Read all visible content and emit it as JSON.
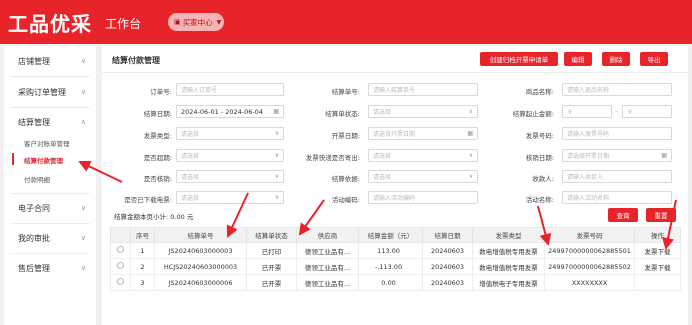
{
  "header": {
    "logo": "工品优采",
    "workbench": "工作台",
    "org_label": "买家中心"
  },
  "sidebar": {
    "items": [
      {
        "label": "店铺管理"
      },
      {
        "label": "采购订单管理"
      },
      {
        "label": "结算管理"
      },
      {
        "label": "电子合同"
      },
      {
        "label": "我的审批"
      },
      {
        "label": "售后管理"
      }
    ],
    "sub_items": [
      {
        "label": "客户对账单管理"
      },
      {
        "label": "结算付款管理"
      },
      {
        "label": "付款明细"
      }
    ]
  },
  "page": {
    "title": "结算付款管理",
    "buttons": {
      "create": "创建归档开票申请单",
      "edit": "编辑",
      "delete": "删除",
      "export": "导出",
      "search": "查询",
      "reset": "重置"
    }
  },
  "filters": {
    "order_no": {
      "label": "订单号:",
      "placeholder": "请输入订单号"
    },
    "settle_no": {
      "label": "结算单号:",
      "placeholder": "请输入结算单号"
    },
    "product_name": {
      "label": "商品名称:",
      "placeholder": "请输入商品名称"
    },
    "settle_date": {
      "label": "结算日期:",
      "value": "2024-06-01 - 2024-06-04"
    },
    "settle_status": {
      "label": "结算单状态:",
      "placeholder": "请选择"
    },
    "settle_start_amount": {
      "label": "结算起止金额:",
      "placeholder_from": "￥",
      "placeholder_to": "￥"
    },
    "invoice_type": {
      "label": "发票类型:",
      "placeholder": "请选择"
    },
    "invoice_date": {
      "label": "开票日期:",
      "placeholder": "请选择开票日期"
    },
    "invoice_no": {
      "label": "发票号码:",
      "placeholder": "请输入发票号码"
    },
    "is_overdue": {
      "label": "是否超期:",
      "placeholder": "请选择"
    },
    "express_sent": {
      "label": "发票快递是否寄出:",
      "placeholder": "请选择"
    },
    "verify_date": {
      "label": "核销日期:",
      "placeholder": "请选择开票日期"
    },
    "is_verified": {
      "label": "是否核销:",
      "placeholder": "请选择"
    },
    "settle_basis": {
      "label": "结算依据:",
      "placeholder": "请选择"
    },
    "payee": {
      "label": "收款人:",
      "placeholder": "请输入收款人"
    },
    "e_invoice_downloaded": {
      "label": "是否已下载电票:",
      "placeholder": "请选择"
    },
    "activity_code": {
      "label": "活动编码:",
      "placeholder": "请输入活动编码"
    },
    "activity_name": {
      "label": "活动名称:",
      "placeholder": "请输入活动名称"
    }
  },
  "totals": {
    "label": "结算金额本页小计:",
    "value": "0.00 元"
  },
  "table": {
    "columns": [
      "序号",
      "结算单号",
      "结算单状态",
      "供应商",
      "结算金额（元）",
      "结算日期",
      "发票类型",
      "发票号码",
      "操作"
    ],
    "rows": [
      {
        "idx": "1",
        "settle_no": "JS20240603000003",
        "status": "已打印",
        "supplier": "德领工业品有...",
        "amount": "113.00",
        "date": "20240603",
        "invoice_type": "数电增值税专用发票",
        "invoice_no": "24997000000062885501",
        "action": "发票下载"
      },
      {
        "idx": "2",
        "settle_no": "HCJS20240603000003",
        "status": "已开票",
        "supplier": "德领工业品有...",
        "amount": "-,113.00",
        "date": "20240603",
        "invoice_type": "数电增值税专用发票",
        "invoice_no": "24997000000062885502",
        "action": "发票下载"
      },
      {
        "idx": "3",
        "settle_no": "JS20240603000006",
        "status": "已开票",
        "supplier": "德领工业品有...",
        "amount": "0.00",
        "date": "20240603",
        "invoice_type": "增值税电子专用发票",
        "invoice_no": "XXXXXXXX",
        "action": ""
      }
    ]
  },
  "icons": {
    "calendar": "calendar-icon",
    "chevron": "chevron-down-icon"
  },
  "colors": {
    "brand": "#e8242b",
    "link": "#1f6fd1"
  }
}
